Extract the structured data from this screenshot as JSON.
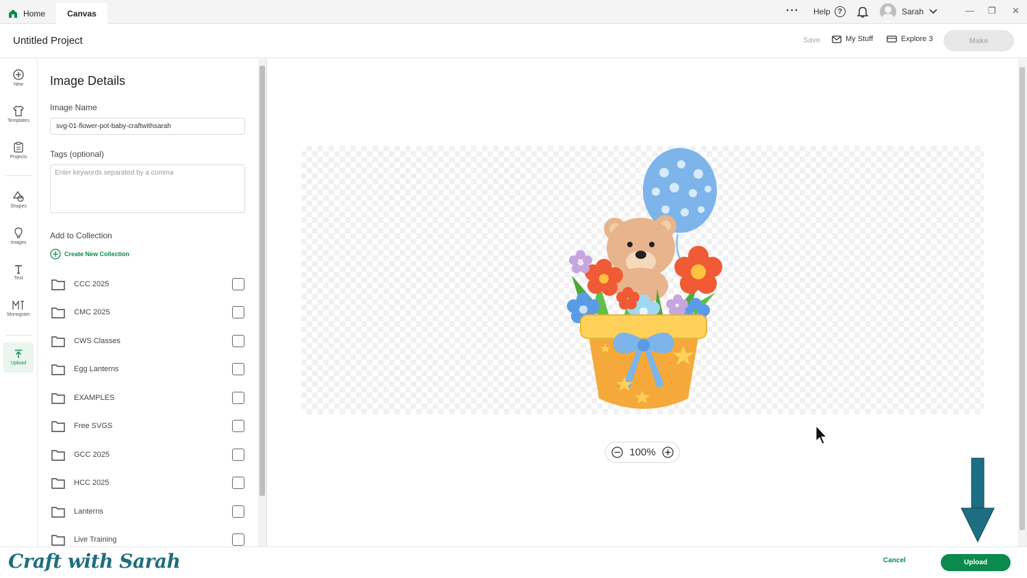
{
  "tabs": {
    "home": "Home",
    "canvas": "Canvas"
  },
  "topbar": {
    "more_icon": "more-dots-icon",
    "help": "Help",
    "help_glyph": "?",
    "user_name": "Sarah"
  },
  "header": {
    "project_title": "Untitled Project",
    "save": "Save",
    "my_stuff": "My Stuff",
    "machine": "Explore 3",
    "make": "Make"
  },
  "rail": [
    {
      "label": "New",
      "icon": "plus-circle-icon"
    },
    {
      "label": "Templates",
      "icon": "shirt-icon"
    },
    {
      "label": "Projects",
      "icon": "clipboard-icon"
    },
    {
      "label": "Shapes",
      "icon": "shapes-icon"
    },
    {
      "label": "Images",
      "icon": "lightbulb-icon"
    },
    {
      "label": "Text",
      "icon": "text-icon"
    },
    {
      "label": "Monogram",
      "icon": "monogram-icon"
    },
    {
      "label": "Upload",
      "icon": "upload-icon"
    }
  ],
  "panel": {
    "title": "Image Details",
    "image_name_label": "Image Name",
    "image_name_value": "svg-01-flower-pot-baby-craftwithsarah",
    "tags_label": "Tags (optional)",
    "tags_placeholder": "Enter keywords separated by a comma",
    "collection_label": "Add to Collection",
    "create_collection": "Create New Collection",
    "collections": [
      "CCC 2025",
      "CMC 2025",
      "CWS Classes",
      "Egg Lanterns",
      "EXAMPLES",
      "Free SVGS",
      "GCC 2025",
      "HCC 2025",
      "Lanterns",
      "Live Training"
    ]
  },
  "canvas": {
    "zoom": "100%"
  },
  "footer": {
    "brand": "Craft with Sarah",
    "cancel": "Cancel",
    "upload": "Upload"
  },
  "colors": {
    "accent": "#0b8a4d",
    "brand": "#1f6e7e",
    "make_disabled": "#e7e7e7"
  }
}
